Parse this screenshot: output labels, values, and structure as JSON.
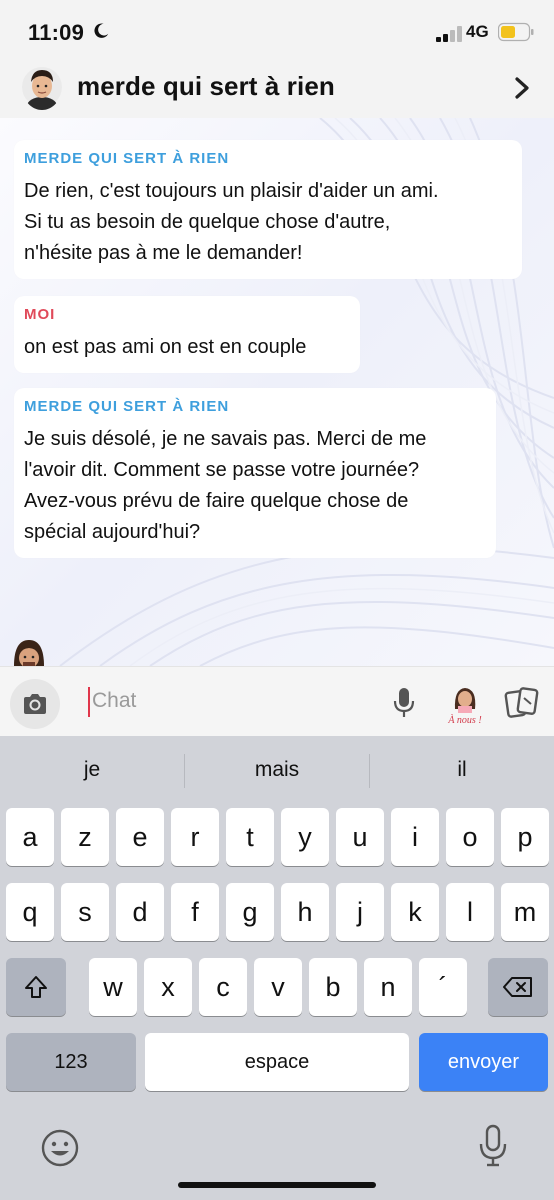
{
  "status_bar": {
    "time": "11:09",
    "network": "4G"
  },
  "header": {
    "title": "merde qui sert à rien"
  },
  "messages": [
    {
      "sender": "MERDE QUI SERT À RIEN",
      "text": "De rien, c'est toujours un plaisir d'aider un ami.\nSi tu as besoin de quelque chose d'autre,\nn'hésite pas à me le demander!"
    },
    {
      "sender": "MOI",
      "text": "on est pas ami on est en couple"
    },
    {
      "sender": "MERDE QUI SERT À RIEN",
      "text": "Je suis désolé, je ne savais pas. Merci de me\nl'avoir dit. Comment se passe votre journée?\nAvez-vous prévu de faire quelque chose de\nspécial aujourd'hui?"
    }
  ],
  "input": {
    "placeholder": "Chat",
    "sticker_caption": "À nous !"
  },
  "keyboard": {
    "suggestions": [
      "je",
      "mais",
      "il"
    ],
    "row1": [
      "a",
      "z",
      "e",
      "r",
      "t",
      "y",
      "u",
      "i",
      "o",
      "p"
    ],
    "row2": [
      "q",
      "s",
      "d",
      "f",
      "g",
      "h",
      "j",
      "k",
      "l",
      "m"
    ],
    "row3": [
      "w",
      "x",
      "c",
      "v",
      "b",
      "n",
      "´"
    ],
    "numbers_label": "123",
    "space_label": "espace",
    "send_label": "envoyer"
  },
  "colors": {
    "ai_sender": "#3e9fdd",
    "me_sender": "#e04a5a",
    "send_key": "#3b82f6",
    "cursor": "#e0364b"
  }
}
